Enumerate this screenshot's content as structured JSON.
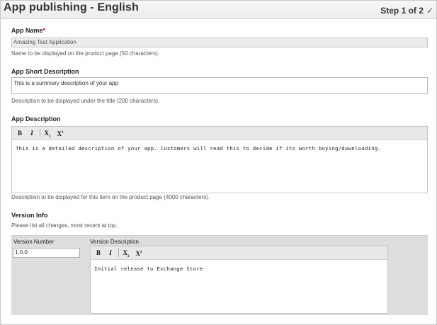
{
  "header": {
    "title": "App publishing - English",
    "step": "Step 1 of 2",
    "step_icon": "checkmark-icon"
  },
  "app_name": {
    "label": "App Name",
    "required_mark": "*",
    "value": "Amazing Test Application",
    "help": "Name to be displayed on the product page (50 characters)."
  },
  "short_description": {
    "label": "App Short Description",
    "value": "This is a summary description of your app",
    "help": "Description to be displayed under the title (200 characters)."
  },
  "description": {
    "label": "App Description",
    "toolbar": {
      "bold": "B",
      "italic": "I",
      "subscript": "X",
      "sub_mark": "2",
      "superscript": "X",
      "sup_mark": "2"
    },
    "value": "This is a detailed description of your app. Customers will read this to decide if its worth buying/downloading.",
    "help": "Description to be displayed for this item on the product page (4000 characters)."
  },
  "version_info": {
    "label": "Version Info",
    "help": "Please list all changes, most recent at top.",
    "number_label": "Version Number",
    "number_value": "1.0.0",
    "description_label": "Version Description",
    "toolbar": {
      "bold": "B",
      "italic": "I",
      "subscript": "X",
      "sub_mark": "2",
      "superscript": "X",
      "sup_mark": "2"
    },
    "description_value": "Initial release to Exchange Store"
  }
}
